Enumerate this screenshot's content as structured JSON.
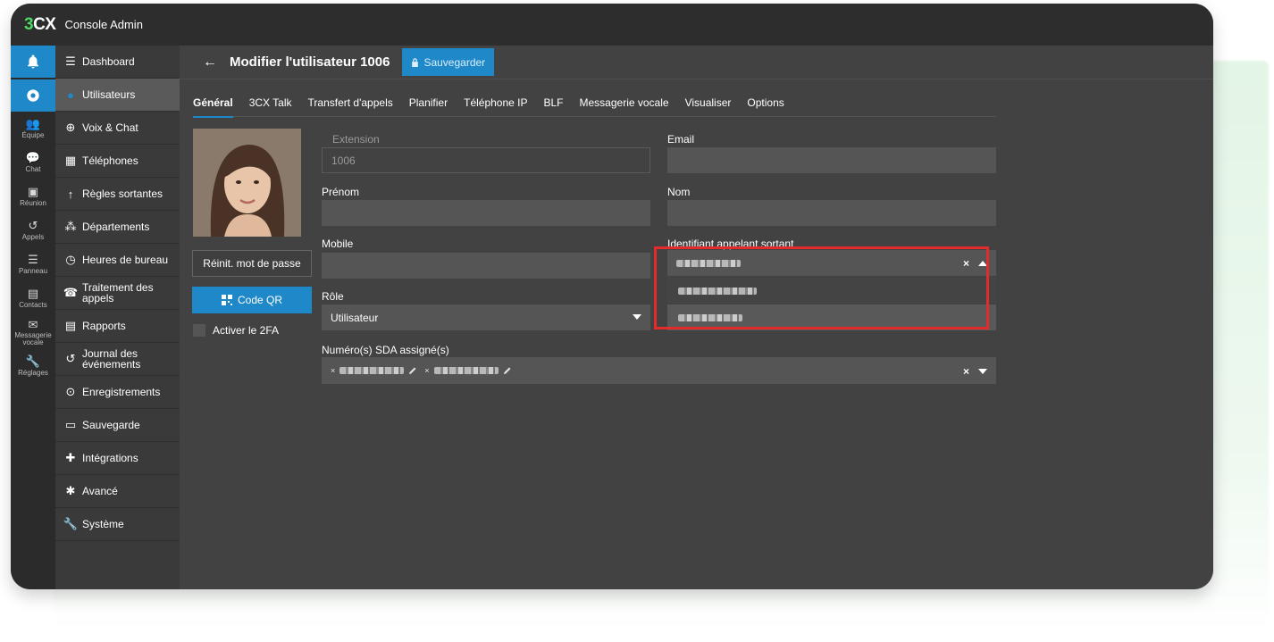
{
  "app": {
    "logo_3": "3",
    "logo_cx": "CX",
    "title": "Console Admin"
  },
  "rail": {
    "items": [
      {
        "icon": "👥",
        "label": "Équipe"
      },
      {
        "icon": "💬",
        "label": "Chat"
      },
      {
        "icon": "▣",
        "label": "Réunion"
      },
      {
        "icon": "↺",
        "label": "Appels"
      },
      {
        "icon": "☰",
        "label": "Panneau"
      },
      {
        "icon": "▤",
        "label": "Contacts"
      },
      {
        "icon": "✉",
        "label": "Messagerie vocale"
      },
      {
        "icon": "🔧",
        "label": "Réglages"
      }
    ]
  },
  "nav": {
    "items": [
      {
        "icon": "☰",
        "label": "Dashboard"
      },
      {
        "icon": "●",
        "label": "Utilisateurs"
      },
      {
        "icon": "⊕",
        "label": "Voix & Chat"
      },
      {
        "icon": "▦",
        "label": "Téléphones"
      },
      {
        "icon": "↑",
        "label": "Règles sortantes"
      },
      {
        "icon": "⁂",
        "label": "Départements"
      },
      {
        "icon": "◷",
        "label": "Heures de bureau"
      },
      {
        "icon": "☎",
        "label": "Traitement des appels"
      },
      {
        "icon": "▤",
        "label": "Rapports"
      },
      {
        "icon": "↺",
        "label": "Journal des événements"
      },
      {
        "icon": "⊙",
        "label": "Enregistrements"
      },
      {
        "icon": "▭",
        "label": "Sauvegarde"
      },
      {
        "icon": "✚",
        "label": "Intégrations"
      },
      {
        "icon": "✱",
        "label": "Avancé"
      },
      {
        "icon": "🔧",
        "label": "Système"
      }
    ]
  },
  "header": {
    "back": "←",
    "title": "Modifier l'utilisateur 1006",
    "save_label": "Sauvegarder"
  },
  "tabs": [
    {
      "label": "Général"
    },
    {
      "label": "3CX Talk"
    },
    {
      "label": "Transfert d'appels"
    },
    {
      "label": "Planifier"
    },
    {
      "label": "Téléphone IP"
    },
    {
      "label": "BLF"
    },
    {
      "label": "Messagerie vocale"
    },
    {
      "label": "Visualiser"
    },
    {
      "label": "Options"
    }
  ],
  "left": {
    "reset_label": "Réinit. mot de passe",
    "qr_label": "Code QR",
    "twofa_label": "Activer le 2FA"
  },
  "form": {
    "extension_label": "Extension",
    "extension_value": "1006",
    "email_label": "Email",
    "prenom_label": "Prénom",
    "nom_label": "Nom",
    "mobile_label": "Mobile",
    "cid_label": "Identifiant appelant sortant",
    "role_label": "Rôle",
    "role_value": "Utilisateur",
    "sda_label": "Numéro(s) SDA assigné(s)",
    "clear_symbol": "×"
  },
  "colors": {
    "accent": "#1e88c9",
    "highlight": "#e32b2b",
    "brand_green": "#4cd964"
  }
}
